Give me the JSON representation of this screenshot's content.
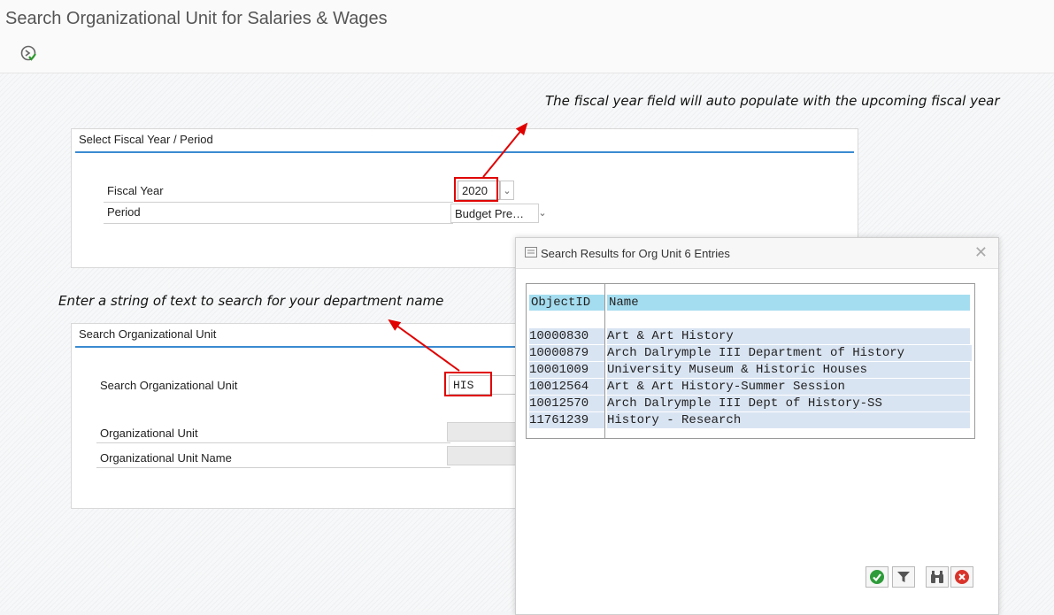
{
  "window": {
    "title": "Search Organizational Unit for Salaries & Wages"
  },
  "annotations": {
    "fiscal_year_note": "The fiscal year field will auto populate with the upcoming fiscal year",
    "search_note": "Enter a string of text to search for your department name"
  },
  "fiscal_group": {
    "heading": "Select Fiscal Year / Period",
    "fiscal_year_label": "Fiscal Year",
    "fiscal_year_value": "2020",
    "period_label": "Period",
    "period_value": "Budget Pre…"
  },
  "search_group": {
    "heading": "Search Organizational Unit",
    "search_label": "Search Organizational Unit",
    "search_value": "HIS",
    "org_unit_label": "Organizational Unit",
    "org_unit_value": "",
    "org_unit_name_label": "Organizational Unit Name",
    "org_unit_name_value": ""
  },
  "dialog": {
    "title": "Search Results for Org Unit 6 Entries",
    "columns": {
      "id": "ObjectID",
      "name": "Name"
    },
    "rows": [
      {
        "id": "10000830",
        "name": "Art & Art History"
      },
      {
        "id": "10000879",
        "name": "Arch Dalrymple III Department of History"
      },
      {
        "id": "10001009",
        "name": "University Museum & Historic Houses"
      },
      {
        "id": "10012564",
        "name": "Art & Art History-Summer Session"
      },
      {
        "id": "10012570",
        "name": "Arch Dalrymple III Dept of History-SS"
      },
      {
        "id": "11761239",
        "name": "History - Research"
      }
    ],
    "buttons": [
      "ok-icon",
      "filter-icon",
      "binoculars-icon",
      "cancel-icon"
    ]
  },
  "colors": {
    "accent_line": "#3b8bd1",
    "highlight": "#e00000",
    "header_row": "#a5ddf0",
    "row_fill": "#d9e4f2"
  }
}
